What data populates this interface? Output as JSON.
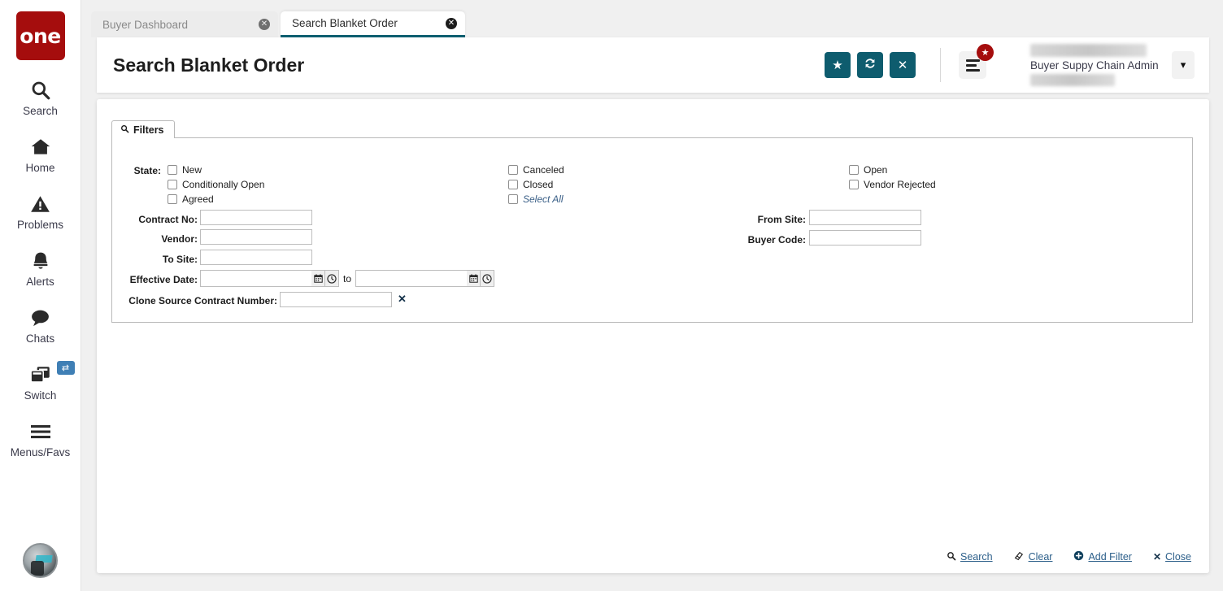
{
  "brand": {
    "logo_text": "one",
    "logo_color": "#a50d0d"
  },
  "left_rail": {
    "items": [
      {
        "label": "Search",
        "icon": "search-icon"
      },
      {
        "label": "Home",
        "icon": "home-icon"
      },
      {
        "label": "Problems",
        "icon": "warning-triangle-icon"
      },
      {
        "label": "Alerts",
        "icon": "bell-icon"
      },
      {
        "label": "Chats",
        "icon": "chat-bubble-icon"
      },
      {
        "label": "Switch",
        "icon": "windows-stack-icon",
        "badge_icon": "swap-arrows-icon"
      },
      {
        "label": "Menus/Favs",
        "icon": "hamburger-icon"
      }
    ],
    "avatar": "user-avatar"
  },
  "tabs": [
    {
      "label": "Buyer Dashboard",
      "active": false,
      "close_icon": "close-circle-icon"
    },
    {
      "label": "Search Blanket Order",
      "active": true,
      "close_icon": "close-circle-icon"
    }
  ],
  "header": {
    "title": "Search Blanket Order",
    "accent_color": "#0e5c6e",
    "buttons": [
      {
        "name": "favorite-button",
        "icon": "star-icon"
      },
      {
        "name": "refresh-button",
        "icon": "refresh-icon"
      },
      {
        "name": "close-button",
        "icon": "x-icon"
      }
    ],
    "menu_button": {
      "icon": "hamburger-icon",
      "badge_icon": "star-icon",
      "badge_color": "#a50d0d"
    },
    "user": {
      "role": "Buyer Suppy Chain Admin",
      "caret_icon": "chevron-down-icon"
    }
  },
  "filters": {
    "tab_label": "Filters",
    "tab_icon": "search-icon",
    "state_label": "State:",
    "state_checkboxes": {
      "column1": [
        {
          "label": "New",
          "checked": false
        },
        {
          "label": "Conditionally Open",
          "checked": false
        },
        {
          "label": "Agreed",
          "checked": false
        }
      ],
      "column2": [
        {
          "label": "Canceled",
          "checked": false,
          "style": "normal"
        },
        {
          "label": "Closed",
          "checked": false,
          "style": "normal"
        },
        {
          "label": "Select All",
          "checked": false,
          "style": "link"
        }
      ],
      "column3": [
        {
          "label": "Open",
          "checked": false
        },
        {
          "label": "Vendor Rejected",
          "checked": false
        }
      ]
    },
    "fields_left": [
      {
        "label": "Contract No:",
        "value": "",
        "placeholder": ""
      },
      {
        "label": "Vendor:",
        "value": "",
        "placeholder": ""
      },
      {
        "label": "To Site:",
        "value": "",
        "placeholder": ""
      }
    ],
    "fields_right": [
      {
        "label": "From Site:",
        "value": "",
        "placeholder": ""
      },
      {
        "label": "Buyer Code:",
        "value": "",
        "placeholder": ""
      }
    ],
    "effective_date": {
      "label": "Effective Date:",
      "from_value": "",
      "to_value": "",
      "separator": "to",
      "calendar_icon": "calendar-icon",
      "clock_icon": "clock-icon"
    },
    "clone_source": {
      "label": "Clone Source Contract Number:",
      "value": "",
      "remove_icon": "x-icon"
    },
    "actions": [
      {
        "label": "Search",
        "icon": "search-icon",
        "name": "search-action"
      },
      {
        "label": "Clear",
        "icon": "eraser-icon",
        "name": "clear-action"
      },
      {
        "label": "Add Filter",
        "icon": "plus-circle-icon",
        "name": "add-filter-action"
      },
      {
        "label": "Close",
        "icon": "x-icon",
        "name": "close-action"
      }
    ]
  }
}
